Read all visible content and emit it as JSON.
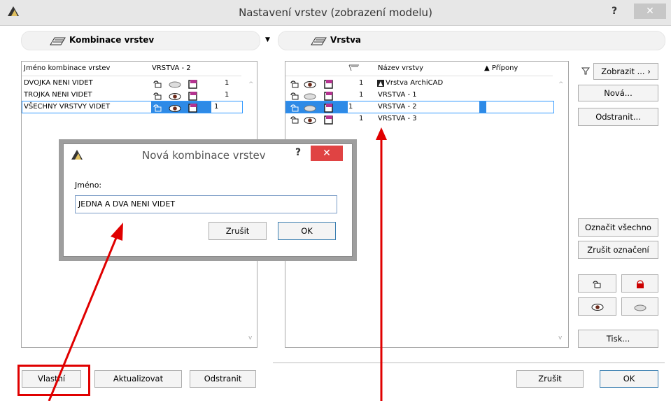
{
  "window": {
    "title": "Nastavení vrstev (zobrazení modelu)",
    "help": "?",
    "close": "✕"
  },
  "left_panel": {
    "header": "Kombinace vrstev",
    "col_name": "Jméno kombinace vrstev",
    "col_current": "VRSTVA - 2",
    "rows": [
      {
        "name": "DVOJKA NENI VIDET",
        "num": "1",
        "visible": false
      },
      {
        "name": "TROJKA NENI VIDET",
        "num": "1",
        "visible": true
      },
      {
        "name": "VŠECHNY VRSTVY VIDET",
        "num": "1",
        "visible": true,
        "selected": true
      }
    ],
    "buttons": {
      "custom": "Vlastní",
      "update": "Aktualizovat",
      "remove": "Odstranit"
    }
  },
  "right_panel": {
    "header": "Vrstva",
    "col_name": "Název vrstvy",
    "col_ext": "▲ Přípony",
    "rows": [
      {
        "num": "1",
        "name": "Vrstva ArchiCAD",
        "visible": true,
        "special": true
      },
      {
        "num": "1",
        "name": "VRSTVA - 1",
        "visible": false
      },
      {
        "num": "1",
        "name": "VRSTVA - 2",
        "visible": false,
        "selected": true
      },
      {
        "num": "1",
        "name": "VRSTVA - 3",
        "visible": true
      }
    ]
  },
  "side_buttons": {
    "show": "Zobrazit ...",
    "new": "Nová...",
    "delete": "Odstranit...",
    "select_all": "Označit všechno",
    "deselect": "Zrušit označení",
    "print": "Tisk..."
  },
  "footer": {
    "cancel": "Zrušit",
    "ok": "OK"
  },
  "dialog": {
    "title": "Nová kombinace vrstev",
    "help": "?",
    "close": "✕",
    "label": "Jméno:",
    "value": "JEDNA A DVA NENI VIDET",
    "cancel": "Zrušit",
    "ok": "OK"
  },
  "colors": {
    "selection": "#2e8ae6",
    "annotation": "#e00000",
    "close_red": "#e04343"
  }
}
